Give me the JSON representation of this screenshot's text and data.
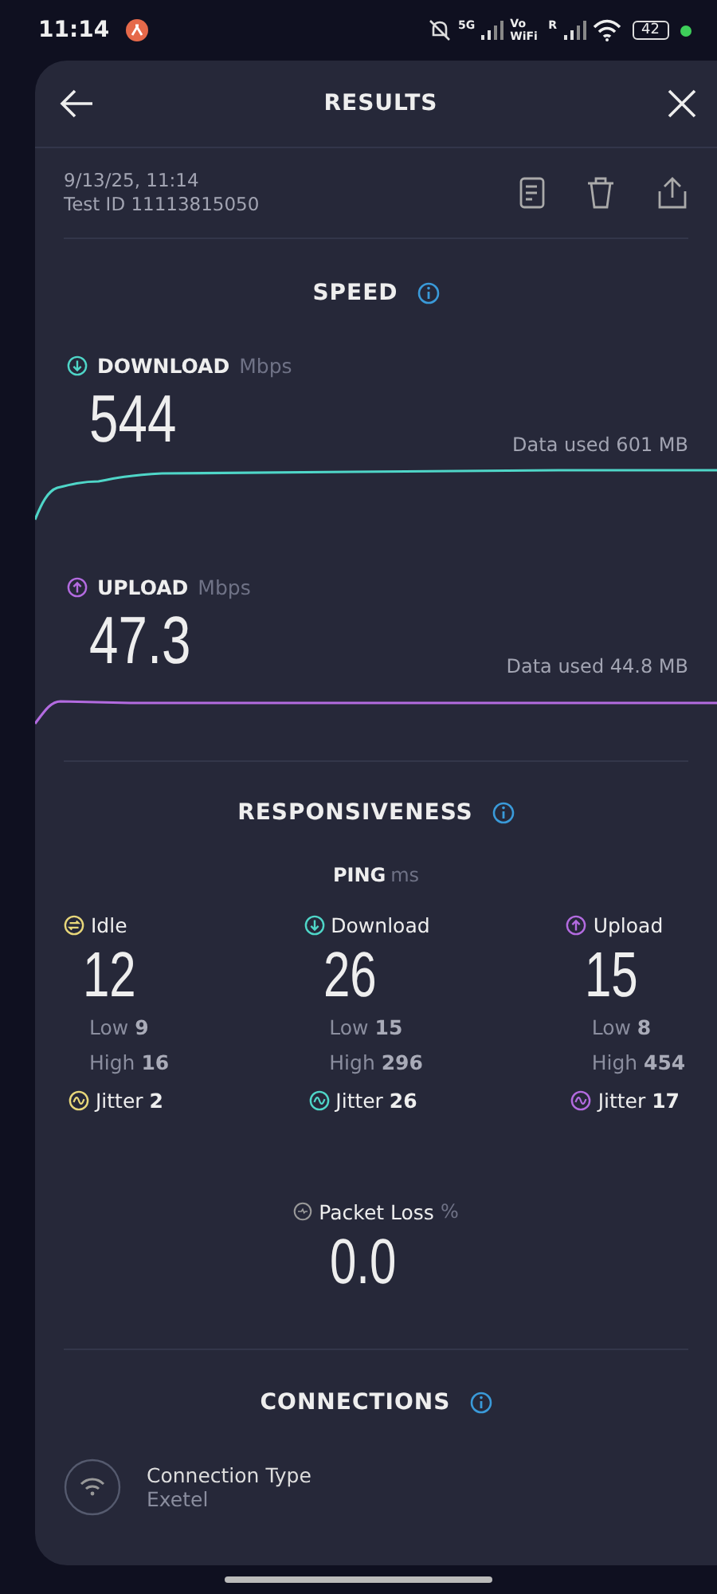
{
  "status_bar": {
    "time": "11:14",
    "network": "5G",
    "wifi_calling": "Vo WiFi",
    "roaming": "R",
    "battery": "42"
  },
  "header": {
    "title": "RESULTS"
  },
  "test": {
    "date": "9/13/25, 11:14",
    "id": "Test ID 11113815050"
  },
  "speed": {
    "title": "SPEED",
    "tests": [
      {
        "kind": "download",
        "label": "DOWNLOAD",
        "unit": "Mbps",
        "value": "544",
        "data_used": "Data used 601 MB",
        "color": "#4fd6c8"
      },
      {
        "kind": "upload",
        "label": "UPLOAD",
        "unit": "Mbps",
        "value": "47.3",
        "data_used": "Data used 44.8 MB",
        "color": "#b36be0"
      }
    ]
  },
  "responsiveness": {
    "title": "RESPONSIVENESS",
    "ping_label": "PING",
    "ping_unit": "ms",
    "columns": [
      {
        "kind": "idle",
        "label": "Idle",
        "value": "12",
        "low": "Low **9**",
        "high": "High **16**",
        "jitter": "Jitter **2**",
        "color": "#e8d77a"
      },
      {
        "kind": "download",
        "label": "Download",
        "value": "26",
        "low": "Low **15**",
        "high": "High **296**",
        "jitter": "Jitter **26**",
        "color": "#4fd6c8"
      },
      {
        "kind": "upload",
        "label": "Upload",
        "value": "15",
        "low": "Low **8**",
        "high": "High **454**",
        "jitter": "Jitter **17**",
        "color": "#b36be0"
      }
    ]
  },
  "packet_loss": {
    "label": "Packet Loss",
    "unit": "%",
    "value": "0.0"
  },
  "connections": {
    "title": "CONNECTIONS",
    "items": [
      {
        "label": "Connection Type",
        "value": "Exetel"
      }
    ]
  }
}
